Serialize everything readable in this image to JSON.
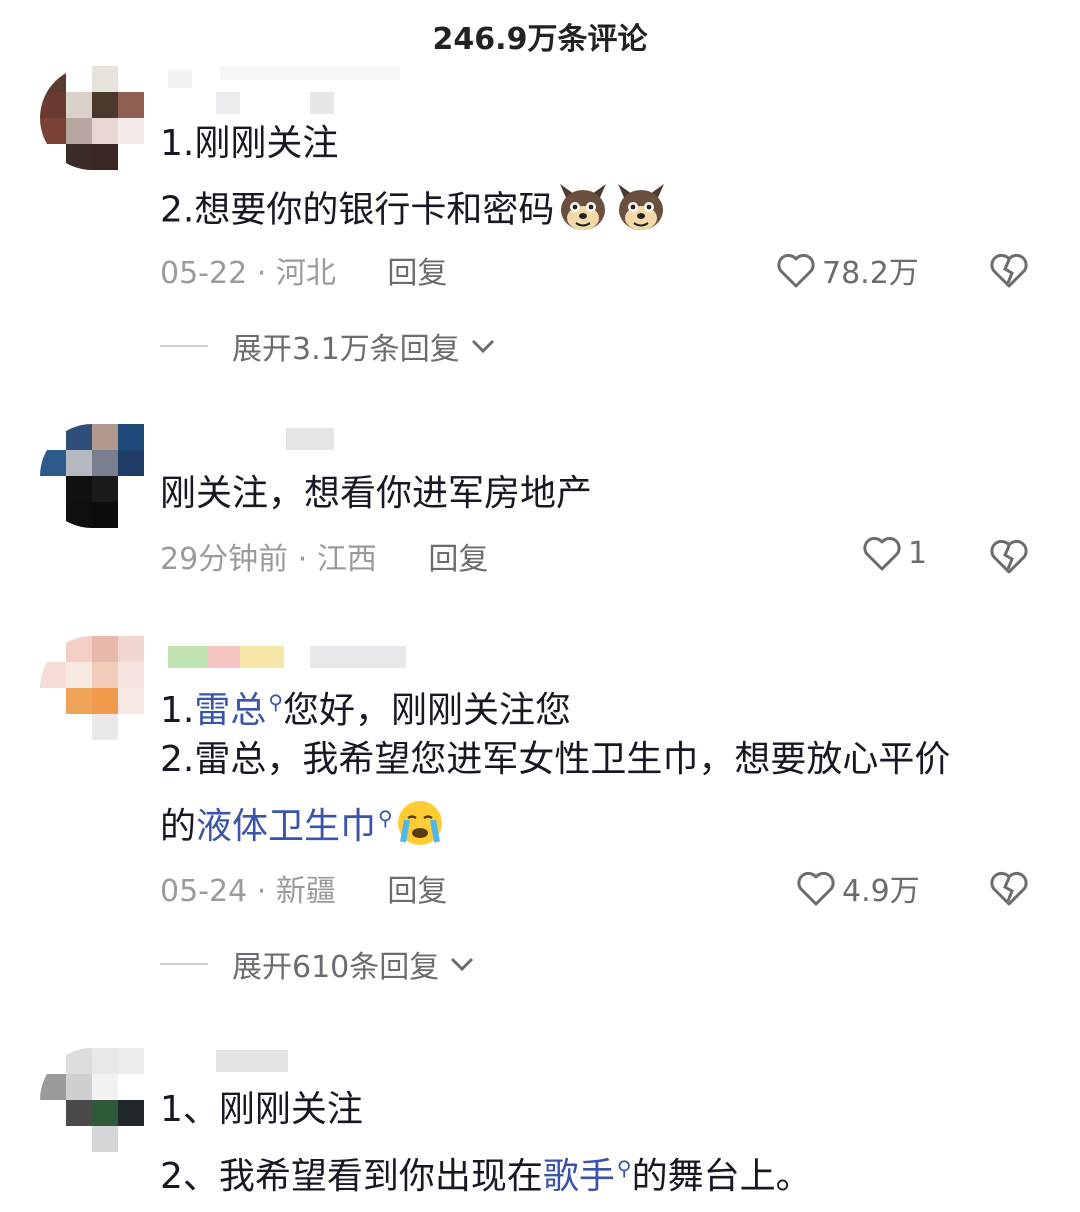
{
  "header": {
    "title": "246.9万条评论"
  },
  "comments": [
    {
      "lines": [
        "1.刚刚关注",
        "2.想要你的银行卡和密码"
      ],
      "date": "05-22",
      "location": "河北",
      "reply": "回复",
      "likes": "78.2万",
      "expand": "展开3.1万条回复"
    },
    {
      "lines": [
        "刚关注，想看你进军房地产"
      ],
      "date": "29分钟前",
      "location": "江西",
      "reply": "回复",
      "likes": "1"
    },
    {
      "line1_prefix": "1.",
      "line1_link": "雷总",
      "line1_suffix": "您好，刚刚关注您",
      "line2": "2.雷总，我希望您进军女性卫生巾，想要放心平价",
      "line3_prefix": "的",
      "line3_link": "液体卫生巾",
      "date": "05-24",
      "location": "新疆",
      "reply": "回复",
      "likes": "4.9万",
      "expand": "展开610条回复"
    },
    {
      "line1": "1、刚刚关注",
      "line2_prefix": "2、我希望看到你出现在",
      "line2_link": "歌手",
      "line2_suffix": "的舞台上。"
    }
  ],
  "separator": "·",
  "icons": {
    "like": "heart-outline-icon",
    "dislike": "broken-heart-icon",
    "expand": "chevron-down-icon",
    "search_hint": "search-icon",
    "emoji_dog": "dog-emoji-icon",
    "emoji_cry": "crying-face-emoji-icon"
  },
  "colors": {
    "link": "#3a55a8",
    "meta": "#9a9aa0",
    "text": "#161823"
  }
}
